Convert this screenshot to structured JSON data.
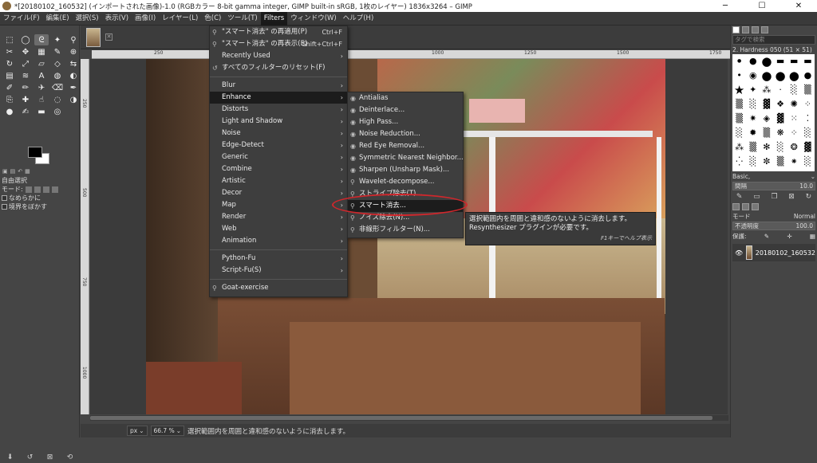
{
  "window": {
    "title": "*[20180102_160532] (インポートされた画像)-1.0 (RGBカラー 8-bit gamma integer, GIMP built-in sRGB, 1枚のレイヤー) 1836x3264 – GIMP",
    "minimize": "─",
    "maximize": "☐",
    "close": "✕"
  },
  "menubar": [
    "ファイル(F)",
    "編集(E)",
    "選択(S)",
    "表示(V)",
    "画像(I)",
    "レイヤー(L)",
    "色(C)",
    "ツール(T)",
    "Filters",
    "ウィンドウ(W)",
    "ヘルプ(H)"
  ],
  "active_menu": "Filters",
  "filters_menu": {
    "top_items": [
      {
        "label": "\"スマート消去\" の再適用(P)",
        "shortcut": "Ctrl+F",
        "icon": "⚲"
      },
      {
        "label": "\"スマート消去\" の再表示(E)",
        "shortcut": "Shift+Ctrl+F",
        "icon": "⚲"
      },
      {
        "label": "Recently Used",
        "arrow": "›"
      },
      {
        "label": "すべてのフィルターのリセット(F)",
        "icon": "↺"
      }
    ],
    "groups": [
      {
        "label": "Blur",
        "arrow": "›"
      },
      {
        "label": "Enhance",
        "arrow": "›"
      },
      {
        "label": "Distorts",
        "arrow": "›"
      },
      {
        "label": "Light and Shadow",
        "arrow": "›"
      },
      {
        "label": "Noise",
        "arrow": "›"
      },
      {
        "label": "Edge-Detect",
        "arrow": "›"
      },
      {
        "label": "Generic",
        "arrow": "›"
      },
      {
        "label": "Combine",
        "arrow": "›"
      },
      {
        "label": "Artistic",
        "arrow": "›"
      },
      {
        "label": "Decor",
        "arrow": "›"
      },
      {
        "label": "Map",
        "arrow": "›"
      },
      {
        "label": "Render",
        "arrow": "›"
      },
      {
        "label": "Web",
        "arrow": "›"
      },
      {
        "label": "Animation",
        "arrow": "›"
      }
    ],
    "script_items": [
      {
        "label": "Python-Fu",
        "arrow": "›"
      },
      {
        "label": "Script-Fu(S)",
        "arrow": "›"
      }
    ],
    "goat": {
      "label": "Goat-exercise",
      "icon": "⚲"
    }
  },
  "enhance_menu": {
    "items": [
      {
        "label": "Antialias",
        "icon": "◉"
      },
      {
        "label": "Deinterlace...",
        "icon": "◉"
      },
      {
        "label": "High Pass...",
        "icon": "◉"
      },
      {
        "label": "Noise Reduction...",
        "icon": "◉"
      },
      {
        "label": "Red Eye Removal...",
        "icon": "◉"
      },
      {
        "label": "Symmetric Nearest Neighbor...",
        "icon": "◉"
      },
      {
        "label": "Sharpen (Unsharp Mask)...",
        "icon": "◉"
      },
      {
        "label": "Wavelet-decompose...",
        "icon": "⚲"
      },
      {
        "label": "ストライプ除去(T)...",
        "icon": "⚲"
      },
      {
        "label": "スマート消去...",
        "icon": "⚲"
      },
      {
        "label": "ノイズ除去(N)...",
        "icon": "⚲"
      },
      {
        "label": "非線形フィルター(N)...",
        "icon": "⚲"
      }
    ],
    "highlighted_index": 9
  },
  "tooltip": {
    "line1": "選択範囲内を周囲と違和感のないように消去します。",
    "line2": "Resynthesizer プラグインが必要です。",
    "hint": "F1キーでヘルプ表示"
  },
  "tool_options": {
    "title": "自由選択",
    "mode_label": "モード:",
    "antialias_label": "なめらかに",
    "feather_label": "境界をぼかす"
  },
  "statusbar": {
    "unit": "px",
    "zoom": "66.7 %",
    "message": "選択範囲内を周囲と違和感のないように消去します。"
  },
  "ruler": {
    "labels": [
      "250",
      "500",
      "750",
      "1000",
      "1250",
      "1500",
      "1750"
    ]
  },
  "right_dock": {
    "filter_placeholder": "タグで検索",
    "brush_name": "2. Hardness 050 (51 × 51)",
    "preset": "Basic,",
    "spacing_label": "間隔",
    "spacing_value": "10.0",
    "mode_label": "モード",
    "mode_value": "Normal",
    "opacity_label": "不透明度",
    "opacity_value": "100.0",
    "lock_label": "保護:",
    "layer_name": "20180102_160532"
  },
  "colors": {
    "accent_red": "#d0272c",
    "menu_bg": "#3e3e3e",
    "highlight": "#1c1c1c"
  }
}
